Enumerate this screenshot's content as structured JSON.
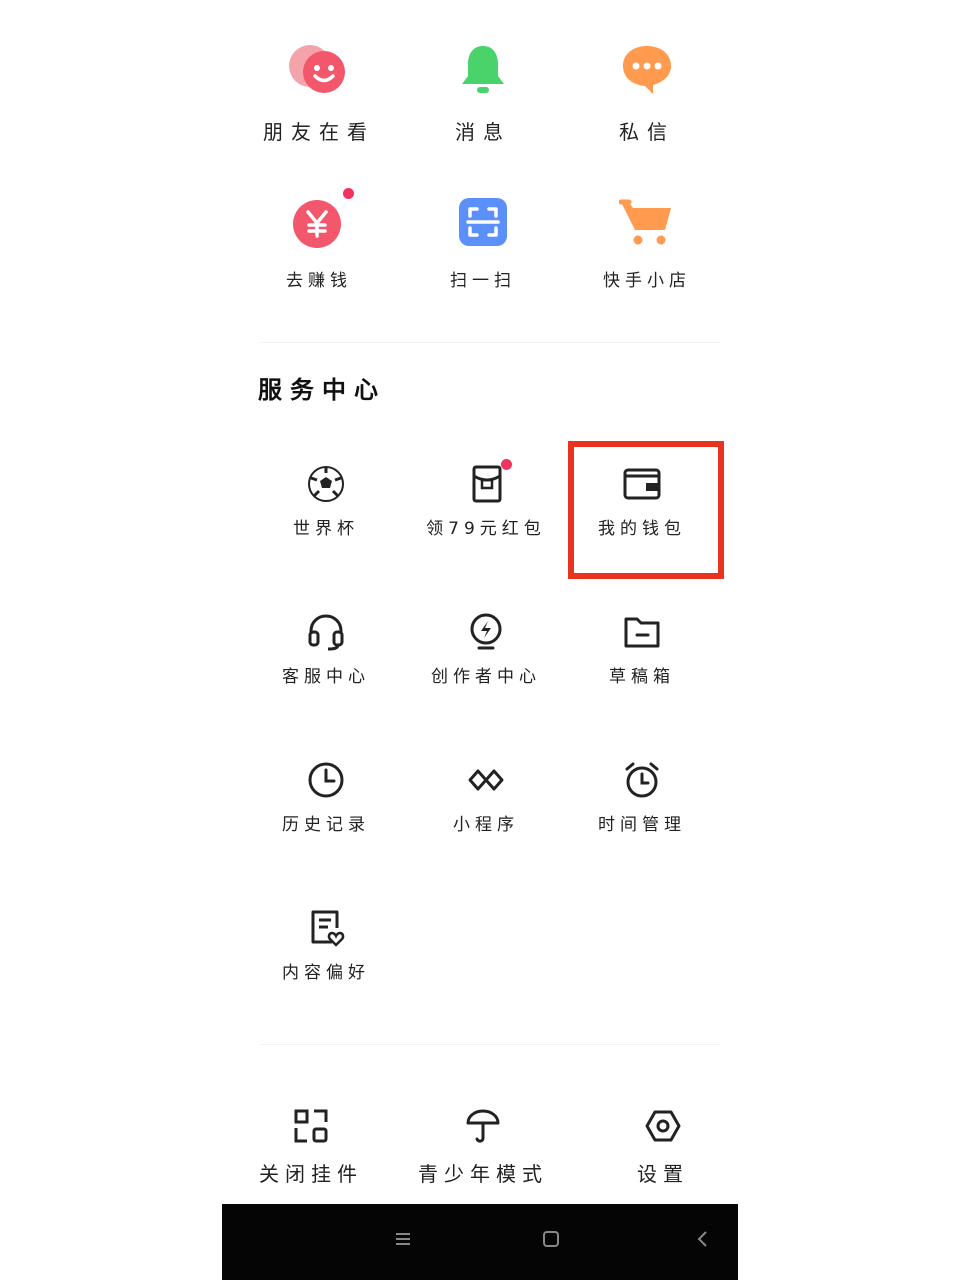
{
  "top_grid": [
    {
      "label": "朋友在看",
      "icon": "friends-watching-icon"
    },
    {
      "label": "消息",
      "icon": "bell-icon"
    },
    {
      "label": "私信",
      "icon": "chat-bubble-icon"
    },
    {
      "label": "去赚钱",
      "icon": "yuan-coin-icon"
    },
    {
      "label": "扫一扫",
      "icon": "scan-icon"
    },
    {
      "label": "快手小店",
      "icon": "shopping-cart-icon"
    }
  ],
  "service_center": {
    "title": "服务中心",
    "items": [
      {
        "label": "世界杯",
        "icon": "soccer-ball-icon"
      },
      {
        "label": "领79元红包",
        "icon": "red-packet-icon"
      },
      {
        "label": "我的钱包",
        "icon": "wallet-icon"
      },
      {
        "label": "客服中心",
        "icon": "headset-icon"
      },
      {
        "label": "创作者中心",
        "icon": "lightning-bulb-icon"
      },
      {
        "label": "草稿箱",
        "icon": "folder-icon"
      },
      {
        "label": "历史记录",
        "icon": "clock-icon"
      },
      {
        "label": "小程序",
        "icon": "mini-program-icon"
      },
      {
        "label": "时间管理",
        "icon": "alarm-clock-icon"
      },
      {
        "label": "内容偏好",
        "icon": "preference-doc-icon"
      }
    ]
  },
  "bottom_bar": [
    {
      "label": "关闭挂件",
      "icon": "widget-icon"
    },
    {
      "label": "青少年模式",
      "icon": "umbrella-icon"
    },
    {
      "label": "设置",
      "icon": "settings-hex-icon"
    }
  ],
  "colors": {
    "highlight": "#e8331f",
    "badge": "#f0335f",
    "scan_blue": "#5b8ff9",
    "bell_green": "#49d36a",
    "chat_orange": "#ff9a4f",
    "cart_orange": "#ff9a4f",
    "pink": "#f2576b"
  }
}
